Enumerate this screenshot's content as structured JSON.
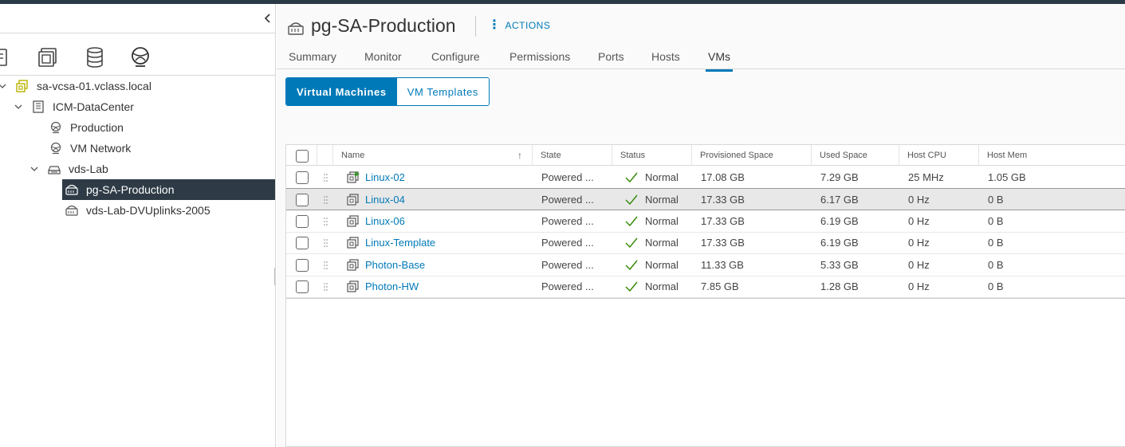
{
  "navigator": {
    "tree": [
      {
        "label": "sa-vcsa-01.vclass.local",
        "icon": "vcenter-icon"
      },
      {
        "label": "ICM-DataCenter",
        "icon": "datacenter-icon"
      },
      {
        "label": "Production",
        "icon": "network-icon"
      },
      {
        "label": "VM Network",
        "icon": "network-icon"
      },
      {
        "label": "vds-Lab",
        "icon": "distributed-switch-icon"
      },
      {
        "label": "pg-SA-Production",
        "icon": "portgroup-icon",
        "selected": true
      },
      {
        "label": "vds-Lab-DVUplinks-2005",
        "icon": "portgroup-icon"
      }
    ]
  },
  "header": {
    "title": "pg-SA-Production",
    "actions_label": "ACTIONS"
  },
  "tabs": [
    "Summary",
    "Monitor",
    "Configure",
    "Permissions",
    "Ports",
    "Hosts",
    "VMs"
  ],
  "active_tab": "VMs",
  "segments": {
    "virtual_machines": "Virtual Machines",
    "vm_templates": "VM Templates"
  },
  "grid": {
    "columns": [
      "Name",
      "State",
      "Status",
      "Provisioned Space",
      "Used Space",
      "Host CPU",
      "Host Mem"
    ],
    "rows": [
      {
        "name": "Linux-02",
        "state": "Powered ...",
        "status": "Normal",
        "provisioned": "17.08 GB",
        "used": "7.29 GB",
        "cpu": "25 MHz",
        "mem": "1.05 GB",
        "powered_on": true
      },
      {
        "name": "Linux-04",
        "state": "Powered ...",
        "status": "Normal",
        "provisioned": "17.33 GB",
        "used": "6.17 GB",
        "cpu": "0 Hz",
        "mem": "0 B",
        "powered_on": false
      },
      {
        "name": "Linux-06",
        "state": "Powered ...",
        "status": "Normal",
        "provisioned": "17.33 GB",
        "used": "6.19 GB",
        "cpu": "0 Hz",
        "mem": "0 B",
        "powered_on": false
      },
      {
        "name": "Linux-Template",
        "state": "Powered ...",
        "status": "Normal",
        "provisioned": "17.33 GB",
        "used": "6.19 GB",
        "cpu": "0 Hz",
        "mem": "0 B",
        "powered_on": false
      },
      {
        "name": "Photon-Base",
        "state": "Powered ...",
        "status": "Normal",
        "provisioned": "11.33 GB",
        "used": "5.33 GB",
        "cpu": "0 Hz",
        "mem": "0 B",
        "powered_on": false
      },
      {
        "name": "Photon-HW",
        "state": "Powered ...",
        "status": "Normal",
        "provisioned": "7.85 GB",
        "used": "1.28 GB",
        "cpu": "0 Hz",
        "mem": "0 B",
        "powered_on": false
      }
    ]
  },
  "colors": {
    "accent": "#0079b8",
    "header_bar": "#2b3a47",
    "selected_tree": "#2e3b46",
    "status_ok": "#318700",
    "power_on": "#3c9a2c"
  }
}
